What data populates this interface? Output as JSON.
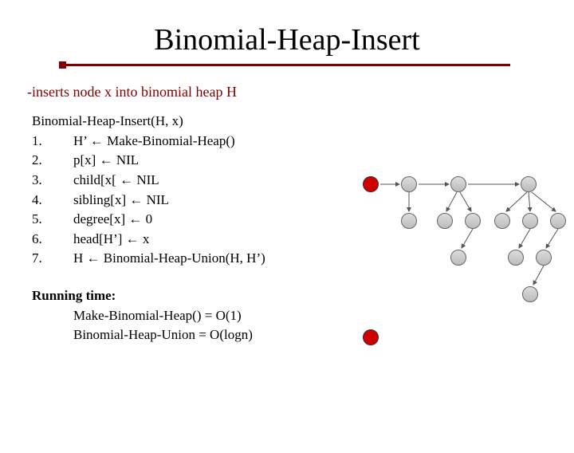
{
  "title": "Binomial-Heap-Insert",
  "subtitle": "-inserts node x into binomial heap H",
  "fn_header": "Binomial-Heap-Insert(H, x)",
  "steps": [
    {
      "n": "1.",
      "body": "H’  ←  Make-Binomial-Heap()"
    },
    {
      "n": "2.",
      "body": "p[x] ← NIL"
    },
    {
      "n": "3.",
      "body": "child[x[ ← NIL"
    },
    {
      "n": "4.",
      "body": "sibling[x] ← NIL"
    },
    {
      "n": "5.",
      "body": "degree[x] ← 0"
    },
    {
      "n": "6.",
      "body": "head[H’] ← x"
    },
    {
      "n": "7.",
      "body": "H ← Binomial-Heap-Union(H, H’)"
    }
  ],
  "running": {
    "header": "Running time:",
    "line1": "Make-Binomial-Heap() = O(1)",
    "line2": "Binomial-Heap-Union  = O(logn)"
  }
}
